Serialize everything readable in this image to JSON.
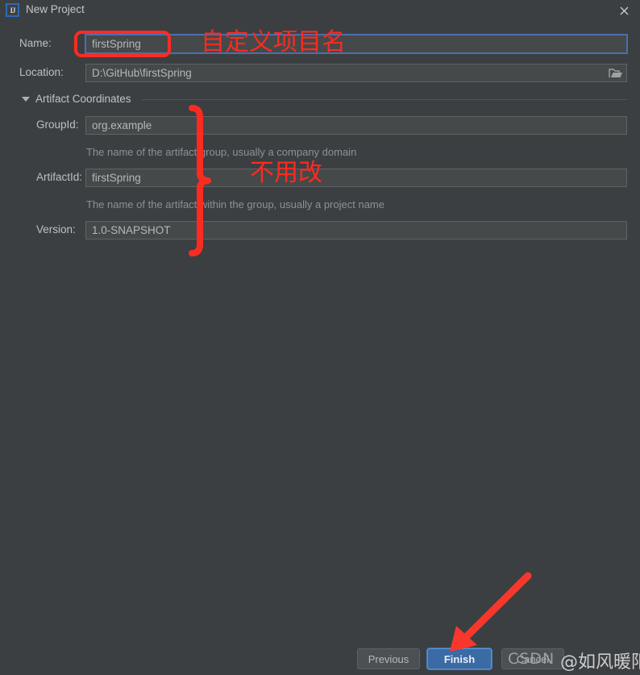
{
  "window": {
    "title": "New Project",
    "app_icon": "intellij-idea-icon",
    "close_icon": "close-icon"
  },
  "form": {
    "name": {
      "label": "Name:",
      "value": "firstSpring"
    },
    "location": {
      "label": "Location:",
      "value": "D:\\GitHub\\firstSpring",
      "browse_icon": "folder-open-icon"
    },
    "artifact_section": {
      "title": "Artifact Coordinates",
      "expanded": true,
      "toggle_icon": "chevron-down-icon"
    },
    "group_id": {
      "label": "GroupId:",
      "value": "org.example",
      "hint": "The name of the artifact group, usually a company domain"
    },
    "artifact_id": {
      "label": "ArtifactId:",
      "value": "firstSpring",
      "hint": "The name of the artifact within the group, usually a project name"
    },
    "version": {
      "label": "Version:",
      "value": "1.0-SNAPSHOT"
    }
  },
  "footer": {
    "previous_label": "Previous",
    "finish_label": "Finish",
    "cancel_label": "Cancel"
  },
  "annotations": {
    "accent_color": "#ff2a1f",
    "name_note": "自定义项目名",
    "artifact_note": "不用改",
    "name_highlight": "name-field-highlight-box",
    "artifact_brace": "artifact-group-brace",
    "finish_arrow": "finish-button-arrow"
  },
  "watermark": {
    "brand": "CSDN",
    "handle": "@如风暖阳"
  },
  "colors": {
    "dialog_bg": "#3c3f41",
    "field_bg": "#45494a",
    "focus_border": "#4b6eaf",
    "default_button": "#3a6ba5",
    "text": "#bdc0c2",
    "hint_text": "#8d9194"
  }
}
